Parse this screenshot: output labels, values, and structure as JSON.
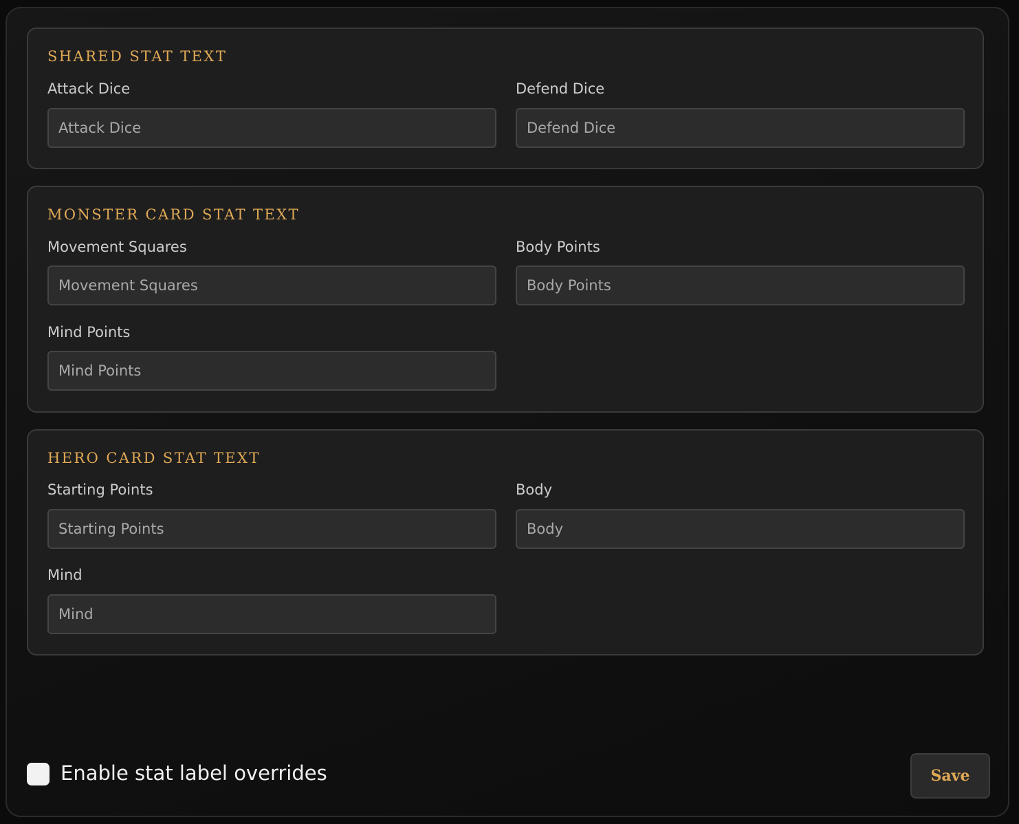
{
  "sections": {
    "shared": {
      "title": "SHARED STAT TEXT",
      "attack_dice": {
        "label": "Attack Dice",
        "placeholder": "Attack Dice",
        "value": ""
      },
      "defend_dice": {
        "label": "Defend Dice",
        "placeholder": "Defend Dice",
        "value": ""
      }
    },
    "monster": {
      "title": "MONSTER CARD STAT TEXT",
      "movement_squares": {
        "label": "Movement Squares",
        "placeholder": "Movement Squares",
        "value": ""
      },
      "body_points": {
        "label": "Body Points",
        "placeholder": "Body Points",
        "value": ""
      },
      "mind_points": {
        "label": "Mind Points",
        "placeholder": "Mind Points",
        "value": ""
      }
    },
    "hero": {
      "title": "HERO CARD STAT TEXT",
      "starting_points": {
        "label": "Starting Points",
        "placeholder": "Starting Points",
        "value": ""
      },
      "body": {
        "label": "Body",
        "placeholder": "Body",
        "value": ""
      },
      "mind": {
        "label": "Mind",
        "placeholder": "Mind",
        "value": ""
      }
    }
  },
  "footer": {
    "enable_overrides_label": "Enable stat label overrides",
    "enable_overrides_checked": false,
    "save_label": "Save"
  },
  "colors": {
    "accent": "#e0a955",
    "background": "#111111",
    "panel": "#1e1e1e",
    "input": "#2c2c2c"
  }
}
